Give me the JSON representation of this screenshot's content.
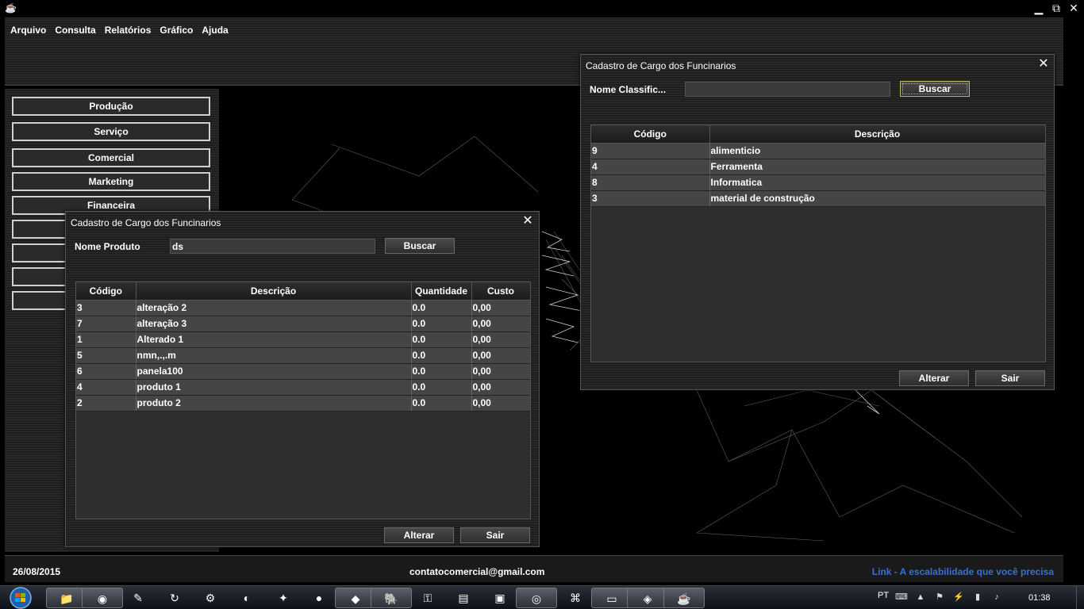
{
  "window": {
    "controls": {
      "minimize": "▁",
      "maximize": "⧉",
      "close": "✕"
    }
  },
  "menu": [
    "Arquivo",
    "Consulta",
    "Relatórios",
    "Gráfico",
    "Ajuda"
  ],
  "sidebar": {
    "buttons": [
      "Produção",
      "Serviço",
      "Comercial",
      "Marketing",
      "Financeira",
      "",
      "",
      "",
      ""
    ]
  },
  "dialog_produto": {
    "title": "Cadastro de Cargo dos Funcinarios",
    "search_label": "Nome Produto",
    "search_value": "ds",
    "search_button": "Buscar",
    "columns": [
      "Código",
      "Descrição",
      "Quantidade",
      "Custo"
    ],
    "rows": [
      [
        "3",
        "alteração 2",
        "0.0",
        "0,00"
      ],
      [
        "7",
        "alteração 3",
        "0.0",
        "0,00"
      ],
      [
        "1",
        "Alterado 1",
        "0.0",
        "0,00"
      ],
      [
        "5",
        "nmn,.,.m",
        "0.0",
        "0,00"
      ],
      [
        "6",
        "panela100",
        "0.0",
        "0,00"
      ],
      [
        "4",
        "produto 1",
        "0.0",
        "0,00"
      ],
      [
        "2",
        "produto 2",
        "0.0",
        "0,00"
      ]
    ],
    "edit_button": "Alterar",
    "exit_button": "Sair"
  },
  "dialog_classificacao": {
    "title": "Cadastro de Cargo dos Funcinarios",
    "search_label": "Nome Classific...",
    "search_value": "",
    "search_button": "Buscar",
    "columns": [
      "Código",
      "Descrição"
    ],
    "rows": [
      [
        "9",
        "alimenticio"
      ],
      [
        "4",
        "Ferramenta"
      ],
      [
        "8",
        "Informatica"
      ],
      [
        "3",
        "material de construção"
      ]
    ],
    "edit_button": "Alterar",
    "exit_button": "Sair"
  },
  "status": {
    "date": "26/08/2015",
    "email": "contatocomercial@gmail.com",
    "link": "Link - A escalabilidade que você precisa"
  },
  "taskbar": {
    "language": "PT",
    "time": "01:38",
    "icons": [
      "file-explorer-icon",
      "chrome-icon",
      "notepad-icon",
      "sync-icon",
      "tool-icon",
      "eclipse-icon",
      "tortoise-icon",
      "gopher-icon",
      "git-icon",
      "postgres-icon",
      "network-icon",
      "server-icon",
      "virtualbox-icon",
      "paint-icon",
      "skype-icon",
      "terminal-icon",
      "remote-icon",
      "java-icon"
    ]
  },
  "colors": {
    "link": "#3a6fd8",
    "background": "#000000",
    "panel": "#262626"
  }
}
